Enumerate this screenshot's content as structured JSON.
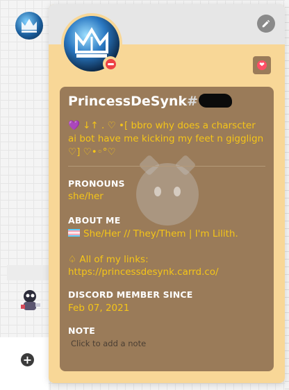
{
  "profile": {
    "username": "PrincessDeSynk",
    "discriminator_prefix": "#",
    "custom_status": "💜 ↓↑ . ♡ •[ bbro why does a charscter ai bot have me kicking my feet n gigglign ♡] ♡•◦°♡",
    "sections": {
      "pronouns": {
        "title": "PRONOUNS",
        "value": "she/her"
      },
      "about_me": {
        "title": "ABOUT ME",
        "line1": "She/Her // They/Them | I'm Lilith.",
        "line2": "♤ All of my links:",
        "line3": "https://princessdesynk.carrd.co/"
      },
      "member_since": {
        "title": "DISCORD MEMBER SINCE",
        "value": "Feb 07, 2021"
      },
      "note": {
        "title": "NOTE",
        "placeholder": "Click to add a note"
      }
    }
  },
  "icons": {
    "edit": "pencil-icon",
    "status": "do-not-disturb-icon",
    "badge": "heart-badge-icon",
    "add": "plus-icon"
  },
  "colors": {
    "popout_background": "#f8d797",
    "card_background": "#9a7b59",
    "accent_text": "#f5c518",
    "dnd": "#ed4245"
  }
}
